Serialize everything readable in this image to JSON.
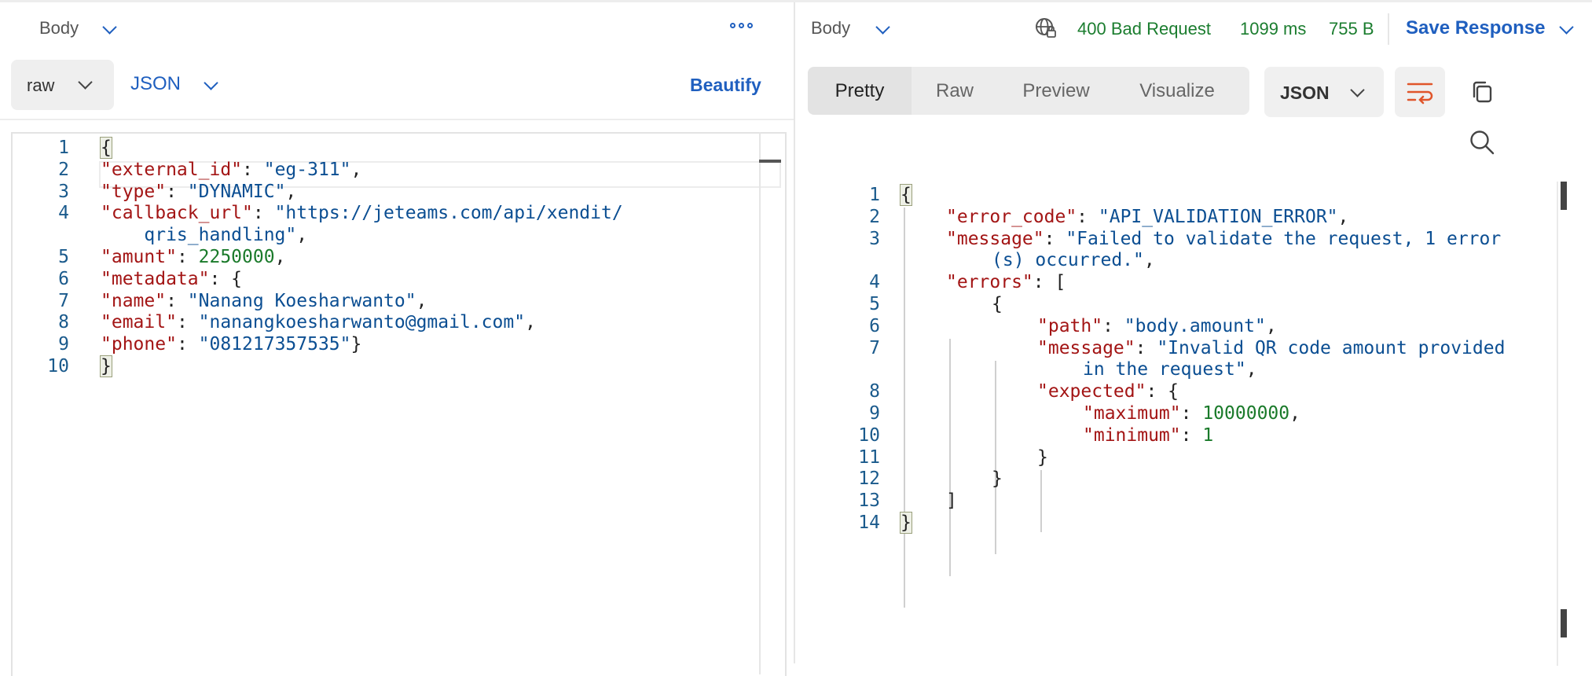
{
  "request": {
    "body_label": "Body",
    "more_icon": "more-horizontal-icon",
    "mode": "raw",
    "format": "JSON",
    "beautify_label": "Beautify",
    "code_lines": [
      {
        "n": "1",
        "tokens": [
          [
            "brace",
            "{"
          ]
        ]
      },
      {
        "n": "2",
        "tokens": [
          [
            "key",
            "\"external_id\""
          ],
          [
            "pun",
            ": "
          ],
          [
            "str",
            "\"eg-311\""
          ],
          [
            "pun",
            ","
          ]
        ]
      },
      {
        "n": "3",
        "tokens": [
          [
            "key",
            "\"type\""
          ],
          [
            "pun",
            ": "
          ],
          [
            "str",
            "\"DYNAMIC\""
          ],
          [
            "pun",
            ","
          ]
        ]
      },
      {
        "n": "4",
        "tokens": [
          [
            "key",
            "\"callback_url\""
          ],
          [
            "pun",
            ": "
          ],
          [
            "str",
            "\"https://jeteams.com/api/xendit/"
          ]
        ]
      },
      {
        "n": "",
        "tokens": [
          [
            "str",
            "    qris_handling\""
          ],
          [
            "pun",
            ","
          ]
        ]
      },
      {
        "n": "5",
        "tokens": [
          [
            "key",
            "\"amunt\""
          ],
          [
            "pun",
            ": "
          ],
          [
            "num",
            "2250000"
          ],
          [
            "pun",
            ","
          ]
        ]
      },
      {
        "n": "6",
        "tokens": [
          [
            "key",
            "\"metadata\""
          ],
          [
            "pun",
            ": {"
          ]
        ]
      },
      {
        "n": "7",
        "tokens": [
          [
            "key",
            "\"name\""
          ],
          [
            "pun",
            ": "
          ],
          [
            "str",
            "\"Nanang Koesharwanto\""
          ],
          [
            "pun",
            ","
          ]
        ]
      },
      {
        "n": "8",
        "tokens": [
          [
            "key",
            "\"email\""
          ],
          [
            "pun",
            ": "
          ],
          [
            "str",
            "\"nanangkoesharwanto@gmail.com\""
          ],
          [
            "pun",
            ","
          ]
        ]
      },
      {
        "n": "9",
        "tokens": [
          [
            "key",
            "\"phone\""
          ],
          [
            "pun",
            ": "
          ],
          [
            "str",
            "\"081217357535\""
          ],
          [
            "pun",
            "}"
          ]
        ]
      },
      {
        "n": "10",
        "tokens": [
          [
            "brace",
            "}"
          ]
        ]
      }
    ]
  },
  "response": {
    "body_label": "Body",
    "globe_icon": "globe-lock-icon",
    "status": "400 Bad Request",
    "time": "1099 ms",
    "size": "755 B",
    "save_label": "Save Response",
    "tabs": [
      "Pretty",
      "Raw",
      "Preview",
      "Visualize"
    ],
    "active_tab": "Pretty",
    "format": "JSON",
    "wrap_icon": "wrap-lines-icon",
    "copy_icon": "copy-icon",
    "search_icon": "search-icon",
    "colors": {
      "status_ok": "#1b7d2f",
      "accent": "#1f5fbf",
      "wrap_icon": "#e0552b"
    },
    "code_lines": [
      {
        "n": "1",
        "indent": 0,
        "tokens": [
          [
            "brace",
            "{"
          ]
        ]
      },
      {
        "n": "2",
        "indent": 1,
        "tokens": [
          [
            "key",
            "\"error_code\""
          ],
          [
            "pun",
            ": "
          ],
          [
            "str",
            "\"API_VALIDATION_ERROR\""
          ],
          [
            "pun",
            ","
          ]
        ]
      },
      {
        "n": "3",
        "indent": 1,
        "tokens": [
          [
            "key",
            "\"message\""
          ],
          [
            "pun",
            ": "
          ],
          [
            "str",
            "\"Failed to validate the request, 1 error"
          ]
        ]
      },
      {
        "n": "",
        "indent": 2,
        "tokens": [
          [
            "str",
            "(s) occurred.\""
          ],
          [
            "pun",
            ","
          ]
        ]
      },
      {
        "n": "4",
        "indent": 1,
        "tokens": [
          [
            "key",
            "\"errors\""
          ],
          [
            "pun",
            ": ["
          ]
        ]
      },
      {
        "n": "5",
        "indent": 2,
        "tokens": [
          [
            "pun",
            "{"
          ]
        ]
      },
      {
        "n": "6",
        "indent": 3,
        "tokens": [
          [
            "key",
            "\"path\""
          ],
          [
            "pun",
            ": "
          ],
          [
            "str",
            "\"body.amount\""
          ],
          [
            "pun",
            ","
          ]
        ]
      },
      {
        "n": "7",
        "indent": 3,
        "tokens": [
          [
            "key",
            "\"message\""
          ],
          [
            "pun",
            ": "
          ],
          [
            "str",
            "\"Invalid QR code amount provided"
          ]
        ]
      },
      {
        "n": "",
        "indent": 4,
        "tokens": [
          [
            "str",
            "in the request\""
          ],
          [
            "pun",
            ","
          ]
        ]
      },
      {
        "n": "8",
        "indent": 3,
        "tokens": [
          [
            "key",
            "\"expected\""
          ],
          [
            "pun",
            ": {"
          ]
        ]
      },
      {
        "n": "9",
        "indent": 4,
        "tokens": [
          [
            "key",
            "\"maximum\""
          ],
          [
            "pun",
            ": "
          ],
          [
            "num",
            "10000000"
          ],
          [
            "pun",
            ","
          ]
        ]
      },
      {
        "n": "10",
        "indent": 4,
        "tokens": [
          [
            "key",
            "\"minimum\""
          ],
          [
            "pun",
            ": "
          ],
          [
            "num",
            "1"
          ]
        ]
      },
      {
        "n": "11",
        "indent": 3,
        "tokens": [
          [
            "pun",
            "}"
          ]
        ]
      },
      {
        "n": "12",
        "indent": 2,
        "tokens": [
          [
            "pun",
            "}"
          ]
        ]
      },
      {
        "n": "13",
        "indent": 1,
        "tokens": [
          [
            "pun",
            "]"
          ]
        ]
      },
      {
        "n": "14",
        "indent": 0,
        "tokens": [
          [
            "brace",
            "}"
          ]
        ]
      }
    ]
  }
}
